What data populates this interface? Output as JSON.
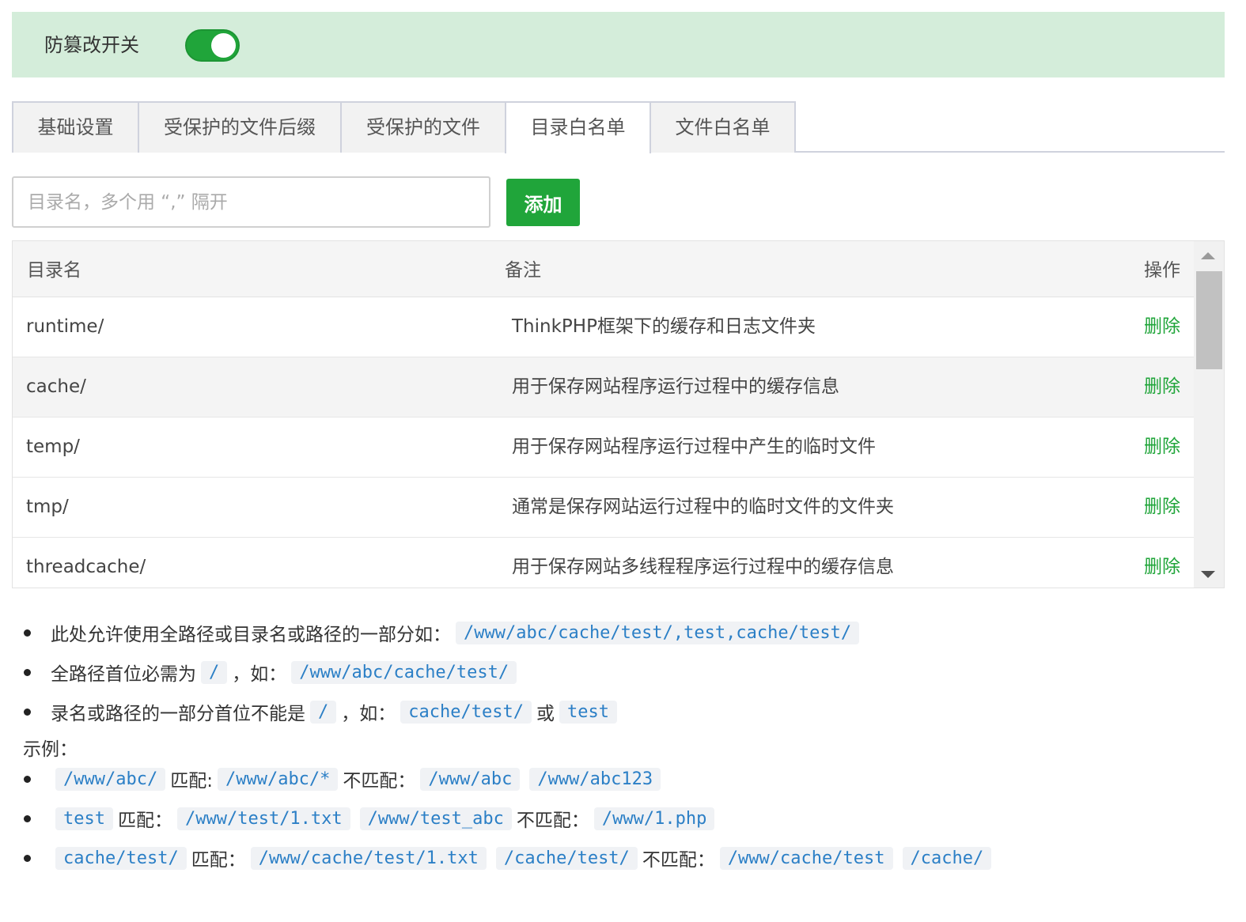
{
  "switch_bar": {
    "label": "防篡改开关",
    "enabled": true
  },
  "tabs": [
    {
      "label": "基础设置",
      "active": false
    },
    {
      "label": "受保护的文件后缀",
      "active": false
    },
    {
      "label": "受保护的文件",
      "active": false
    },
    {
      "label": "目录白名单",
      "active": true
    },
    {
      "label": "文件白名单",
      "active": false
    }
  ],
  "add_form": {
    "placeholder": "目录名，多个用 “,” 隔开",
    "value": "",
    "add_label": "添加"
  },
  "table": {
    "headers": {
      "name": "目录名",
      "note": "备注",
      "op": "操作"
    },
    "rows": [
      {
        "name": "runtime/",
        "note": "ThinkPHP框架下的缓存和日志文件夹",
        "op": "删除"
      },
      {
        "name": "cache/",
        "note": "用于保存网站程序运行过程中的缓存信息",
        "op": "删除"
      },
      {
        "name": "temp/",
        "note": "用于保存网站程序运行过程中产生的临时文件",
        "op": "删除"
      },
      {
        "name": "tmp/",
        "note": "通常是保存网站运行过程中的临时文件的文件夹",
        "op": "删除"
      },
      {
        "name": "threadcache/",
        "note": "用于保存网站多线程程序运行过程中的缓存信息",
        "op": "删除"
      }
    ]
  },
  "help": {
    "line1": {
      "text": "此处允许使用全路径或目录名或路径的一部分如：",
      "code": "/www/abc/cache/test/,test,cache/test/"
    },
    "line2": {
      "text_a": "全路径首位必需为",
      "code_a": "/",
      "text_b": "，如：",
      "code_b": "/www/abc/cache/test/"
    },
    "line3": {
      "text_a": "录名或路径的一部分首位不能是",
      "code_a": "/",
      "text_b": "，如：",
      "code_b": "cache/test/",
      "text_c": "或",
      "code_c": "test"
    },
    "example_title": "示例：",
    "ex1": {
      "pattern": "/www/abc/",
      "match_label": "匹配:",
      "match": "/www/abc/*",
      "nomatch_label": "不匹配：",
      "nomatch_1": "/www/abc",
      "nomatch_2": "/www/abc123"
    },
    "ex2": {
      "pattern": "test",
      "match_label": "匹配：",
      "match_1": "/www/test/1.txt",
      "match_2": "/www/test_abc",
      "nomatch_label": "不匹配：",
      "nomatch_1": "/www/1.php"
    },
    "ex3": {
      "pattern": "cache/test/",
      "match_label": "匹配：",
      "match_1": "/www/cache/test/1.txt",
      "match_2": "/cache/test/",
      "nomatch_label": "不匹配：",
      "nomatch_1": "/www/cache/test",
      "nomatch_2": "/cache/"
    }
  },
  "colors": {
    "accent": "#20a53a",
    "switch_bar_bg": "#d4edda",
    "code_text": "#2b7fc6"
  }
}
